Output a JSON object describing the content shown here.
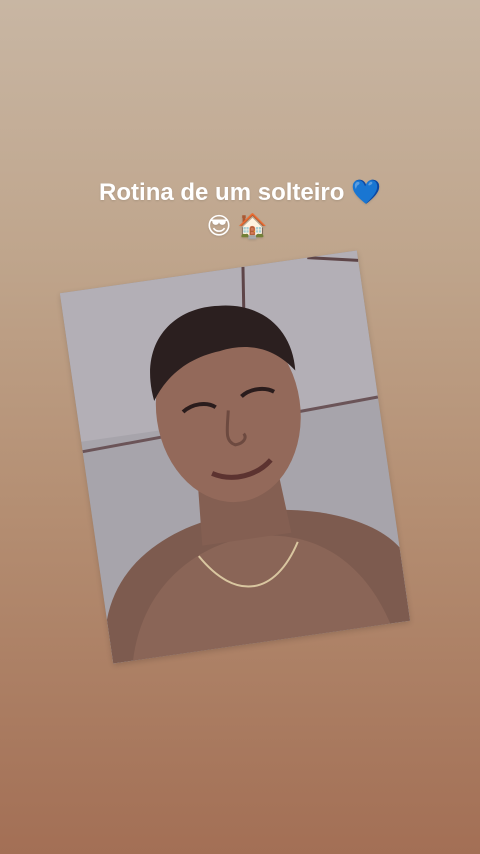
{
  "story": {
    "caption_line_1": "Rotina de um solteiro 💙",
    "caption_line_2": "😎🏠"
  },
  "photo": {
    "subject": "selfie",
    "icon": "photo-icon"
  },
  "colors": {
    "background_top": "#c8b6a3",
    "background_bottom": "#a36f55",
    "caption_text": "#ffffff"
  }
}
